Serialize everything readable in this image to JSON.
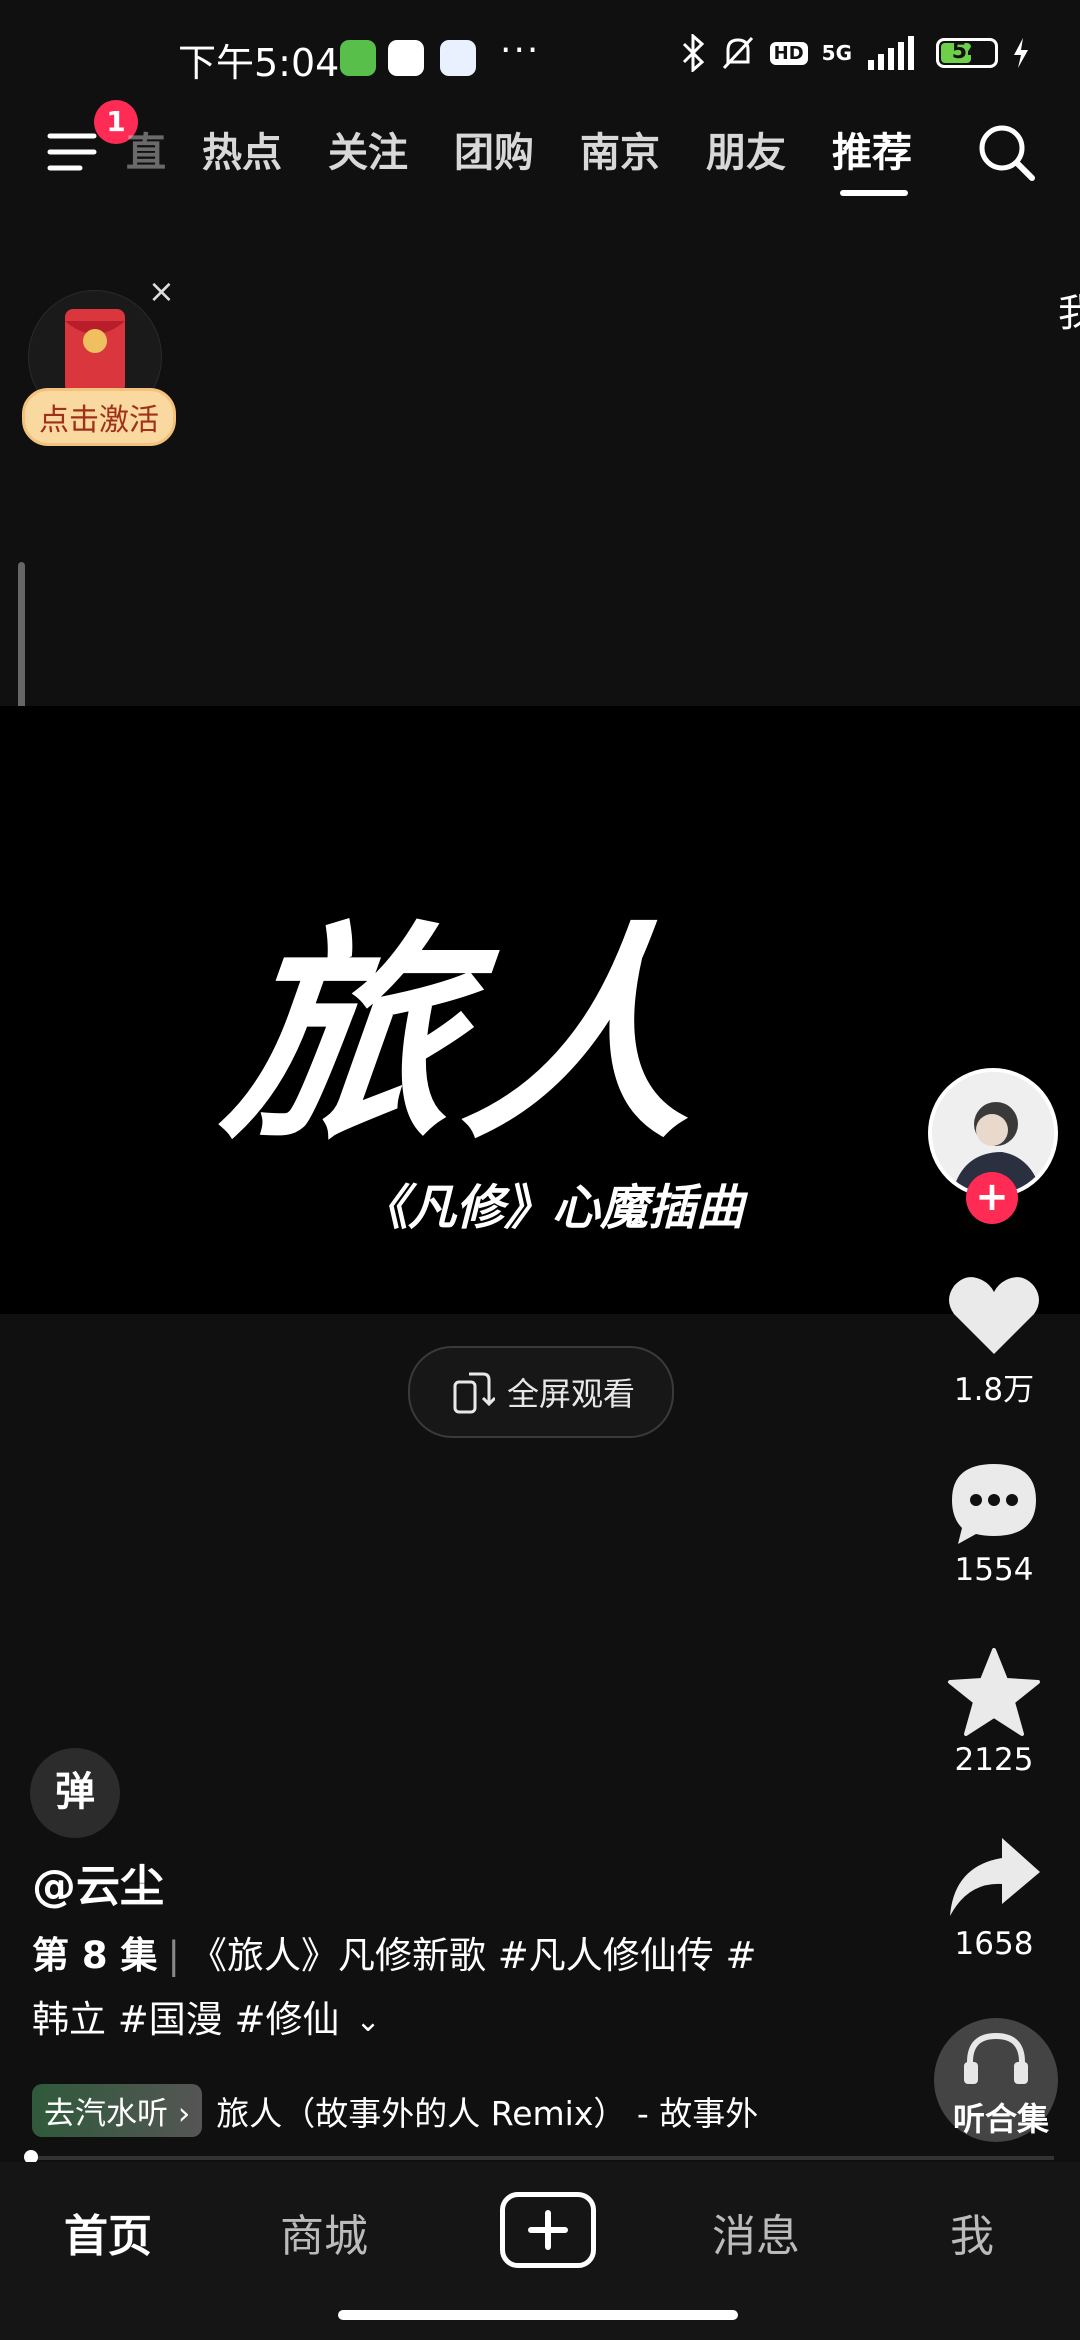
{
  "status_bar": {
    "time": "下午5:04",
    "battery": "54",
    "signal": "5G",
    "hd": "HD",
    "more": "···"
  },
  "top_nav": {
    "menu_badge": "1",
    "partial_tab": "直",
    "tabs": [
      "热点",
      "关注",
      "团购",
      "南京",
      "朋友",
      "推荐"
    ],
    "active_tab": "推荐"
  },
  "red_envelope": {
    "close": "×",
    "label": "点击激活"
  },
  "right_edge_text": "我",
  "video": {
    "title": "旅人",
    "subtitle": "《凡修》心魔插曲",
    "fullscreen_label": "全屏观看"
  },
  "actions": {
    "likes": "1.8万",
    "comments": "1554",
    "favorites": "2125",
    "shares": "1658",
    "listen_label": "听合集"
  },
  "post": {
    "danmu": "弹",
    "author": "@云尘",
    "episode": "第 8 集",
    "sep": "|",
    "text_line1": "《旅人》凡修新歌 #凡人修仙传 #",
    "text_line2": "韩立 #国漫 #修仙"
  },
  "music": {
    "tag": "去汽水听",
    "chevron": "›",
    "track": "旅人（故事外的人 Remix） - 故事外"
  },
  "bottom_tabs": {
    "home": "首页",
    "mall": "商城",
    "messages": "消息",
    "me": "我"
  },
  "colors": {
    "accent": "#fe2c55",
    "background": "#101010",
    "envelope_pill": "#f9d9a0"
  }
}
